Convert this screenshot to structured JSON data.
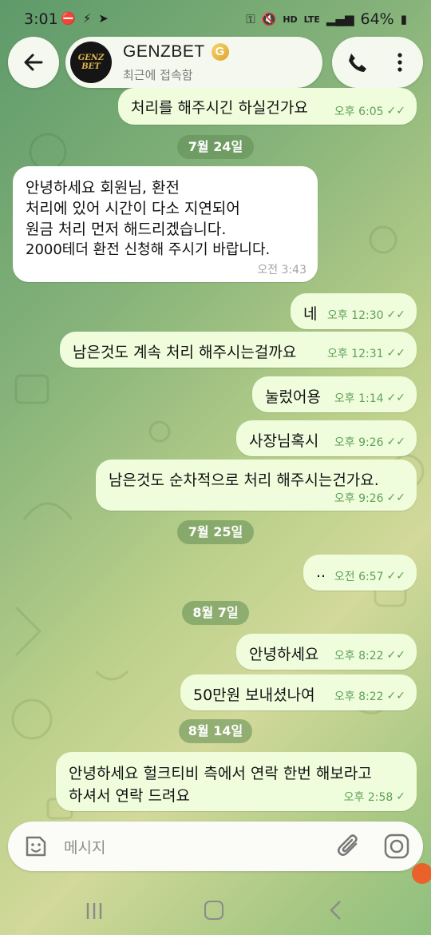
{
  "status_bar": {
    "time": "3:01",
    "battery": "64%",
    "network": "LTE"
  },
  "header": {
    "avatar_line1": "GENZ",
    "avatar_line2": "BET",
    "name": "GENZBET",
    "status": "최근에 접속함"
  },
  "messages": [
    {
      "dir": "out",
      "text": [
        "처리를 해주시긴 하실건가요"
      ],
      "time": "오후 6:05",
      "read": true
    },
    {
      "dir": "date",
      "text": "7월 24일"
    },
    {
      "dir": "in",
      "text": [
        "안녕하세요 회원님, 환전",
        "처리에 있어 시간이 다소 지연되어",
        "원금 처리 먼저 해드리겠습니다.",
        "2000테더 환전 신청해 주시기 바랍니다."
      ],
      "time": "오전 3:43"
    },
    {
      "dir": "out",
      "text": [
        "네"
      ],
      "time": "오후 12:30",
      "read": true
    },
    {
      "dir": "out",
      "text": [
        "남은것도 계속 처리 해주시는걸까요"
      ],
      "time": "오후 12:31",
      "read": true
    },
    {
      "dir": "out",
      "text": [
        "눌렀어용"
      ],
      "time": "오후 1:14",
      "read": true
    },
    {
      "dir": "out",
      "text": [
        "사장님혹시"
      ],
      "time": "오후 9:26",
      "read": true
    },
    {
      "dir": "out",
      "text": [
        "남은것도 순차적으로 처리 해주시는건가요."
      ],
      "time": "오후 9:26",
      "read": true
    },
    {
      "dir": "date",
      "text": "7월 25일"
    },
    {
      "dir": "out",
      "text": [
        ".."
      ],
      "time": "오전 6:57",
      "read": true
    },
    {
      "dir": "date",
      "text": "8월 7일"
    },
    {
      "dir": "out",
      "text": [
        "안녕하세요"
      ],
      "time": "오후 8:22",
      "read": true
    },
    {
      "dir": "out",
      "text": [
        "50만원 보내셨나여"
      ],
      "time": "오후 8:22",
      "read": true
    },
    {
      "dir": "date",
      "text": "8월 14일"
    },
    {
      "dir": "out",
      "text": [
        "안녕하세요 헐크티비 측에서 연락 한번 해보라고",
        "하셔서 연락 드려요"
      ],
      "time": "오후 2:58",
      "read": false
    }
  ],
  "input": {
    "placeholder": "메시지"
  },
  "colors": {
    "outgoing_bubble": "#effddd",
    "incoming_bubble": "#ffffff",
    "check_green": "#5fa157"
  }
}
